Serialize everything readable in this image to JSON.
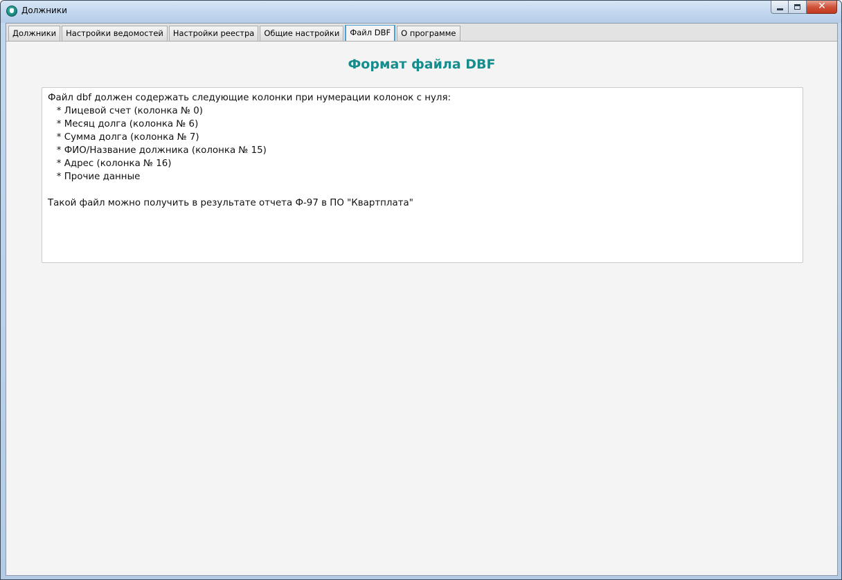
{
  "window": {
    "title": "Должники",
    "controls": {
      "minimize": "minimize",
      "maximize": "maximize",
      "close": "✕"
    }
  },
  "tabs": [
    {
      "label": "Должники",
      "active": false
    },
    {
      "label": "Настройки ведомостей",
      "active": false
    },
    {
      "label": "Настройки реестра",
      "active": false
    },
    {
      "label": "Общие настройки",
      "active": false
    },
    {
      "label": "Файл DBF",
      "active": true
    },
    {
      "label": "О программе",
      "active": false
    }
  ],
  "content": {
    "heading": "Формат файла DBF",
    "text": "Файл dbf должен содержать следующие колонки при нумерации колонок с нуля:\n   * Лицевой счет (колонка № 0)\n   * Месяц долга (колонка № 6)\n   * Сумма долга (колонка № 7)\n   * ФИО/Название должника (колонка № 15)\n   * Адрес (колонка № 16)\n   * Прочие данные\n\nТакой файл можно получить в результате отчета Ф-97 в ПО \"Квартплата\""
  },
  "colors": {
    "heading": "#168c8c",
    "active_tab_border": "#4a9fd4",
    "client_background": "#f4f4f4"
  }
}
